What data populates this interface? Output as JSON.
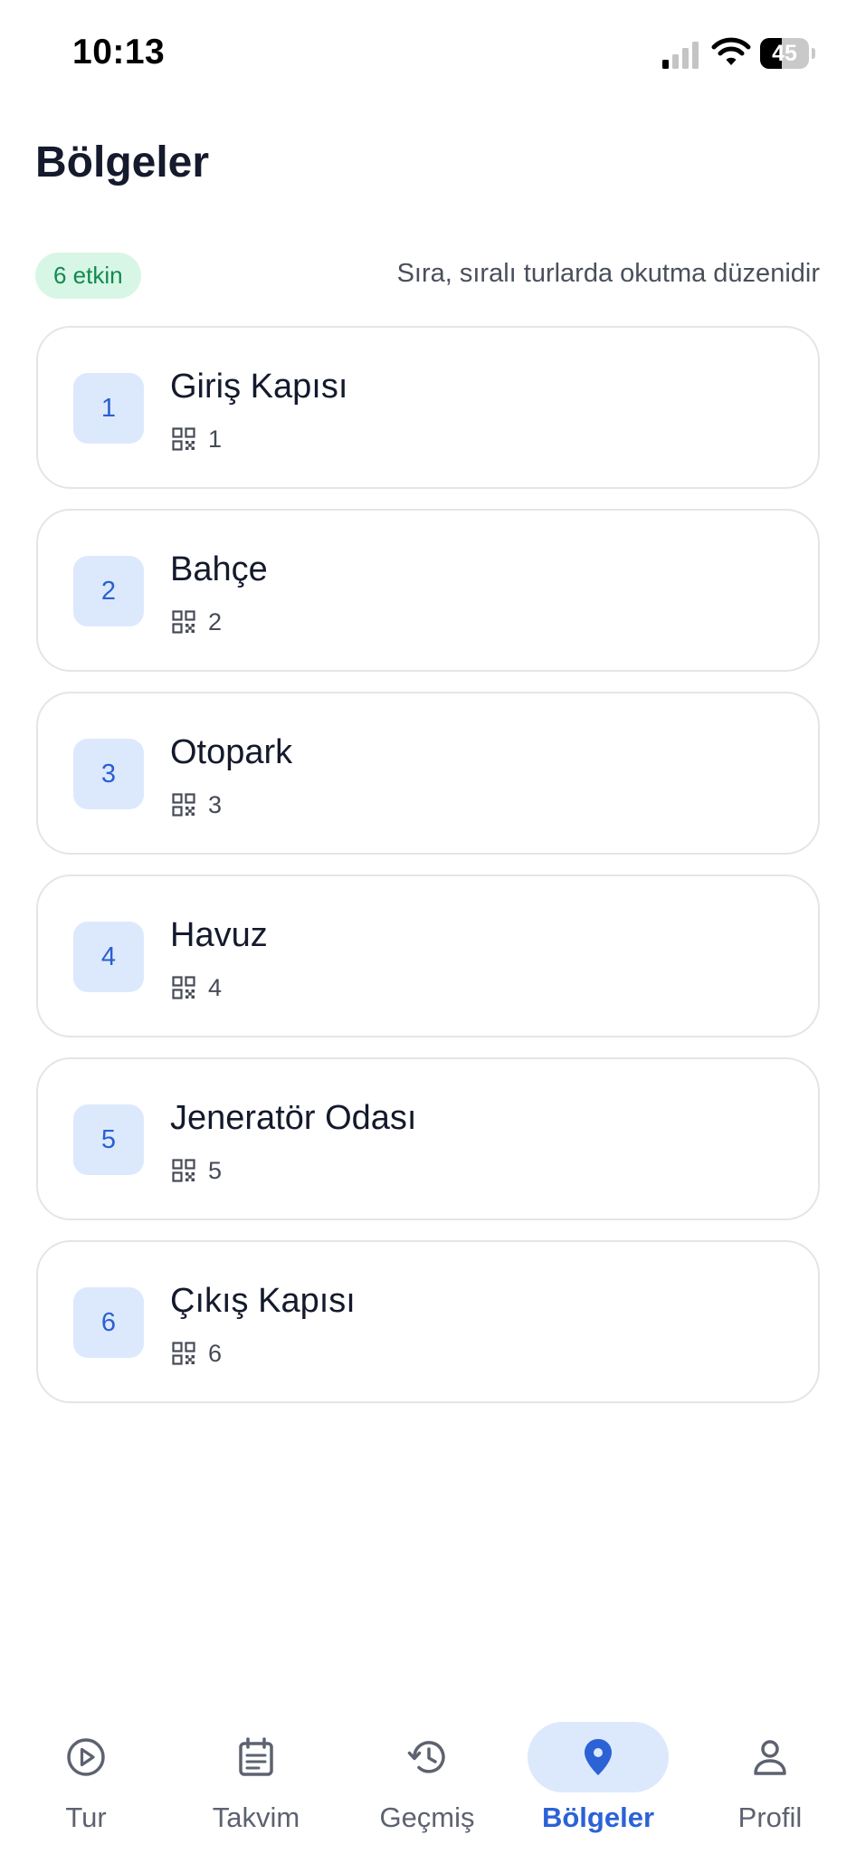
{
  "status_bar": {
    "time": "10:13",
    "battery_percent": "45",
    "battery_level": 0.45,
    "signal_bars_active": 1,
    "signal_bars_total": 4
  },
  "header": {
    "title": "Bölgeler"
  },
  "summary": {
    "active_badge": "6 etkin",
    "order_hint": "Sıra, sıralı turlarda okutma düzenidir"
  },
  "zones": [
    {
      "order": "1",
      "name": "Giriş Kapısı",
      "qr_count": "1"
    },
    {
      "order": "2",
      "name": "Bahçe",
      "qr_count": "2"
    },
    {
      "order": "3",
      "name": "Otopark",
      "qr_count": "3"
    },
    {
      "order": "4",
      "name": "Havuz",
      "qr_count": "4"
    },
    {
      "order": "5",
      "name": "Jeneratör Odası",
      "qr_count": "5"
    },
    {
      "order": "6",
      "name": "Çıkış Kapısı",
      "qr_count": "6"
    }
  ],
  "bottom_nav": {
    "items": [
      {
        "label": "Tur",
        "icon": "play-circle-icon",
        "active": false
      },
      {
        "label": "Takvim",
        "icon": "calendar-icon",
        "active": false
      },
      {
        "label": "Geçmiş",
        "icon": "history-icon",
        "active": false
      },
      {
        "label": "Bölgeler",
        "icon": "location-pin-icon",
        "active": true
      },
      {
        "label": "Profil",
        "icon": "person-icon",
        "active": false
      }
    ]
  },
  "colors": {
    "accent": "#2b62d6",
    "accent_bg": "#dce9fd",
    "badge_bg": "#d8f6e5",
    "badge_text": "#128a52",
    "card_border": "#e3e5ea"
  }
}
